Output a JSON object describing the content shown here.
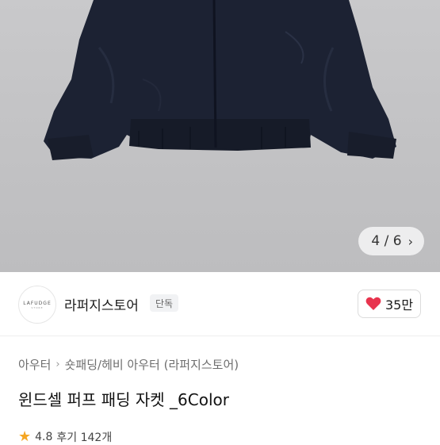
{
  "gallery": {
    "pager_text": "4 / 6",
    "pager_icon": "chevron-right-icon",
    "image_subject": "navy padded jacket"
  },
  "seller": {
    "logo_text": "LAFUDGE",
    "logo_sub": "STORE",
    "name": "라퍼지스토어",
    "badge": "단독",
    "likes": "35만",
    "like_icon": "heart-icon",
    "heart_color": "#e8344e"
  },
  "product": {
    "breadcrumb": [
      "아우터",
      "숏패딩/헤비 아우터 (라퍼지스토어)"
    ],
    "title": "윈드셀 퍼프 패딩 자켓 _6Color",
    "rating": "4.8",
    "reviews": "후기 142개",
    "star_color": "#f5a623"
  }
}
